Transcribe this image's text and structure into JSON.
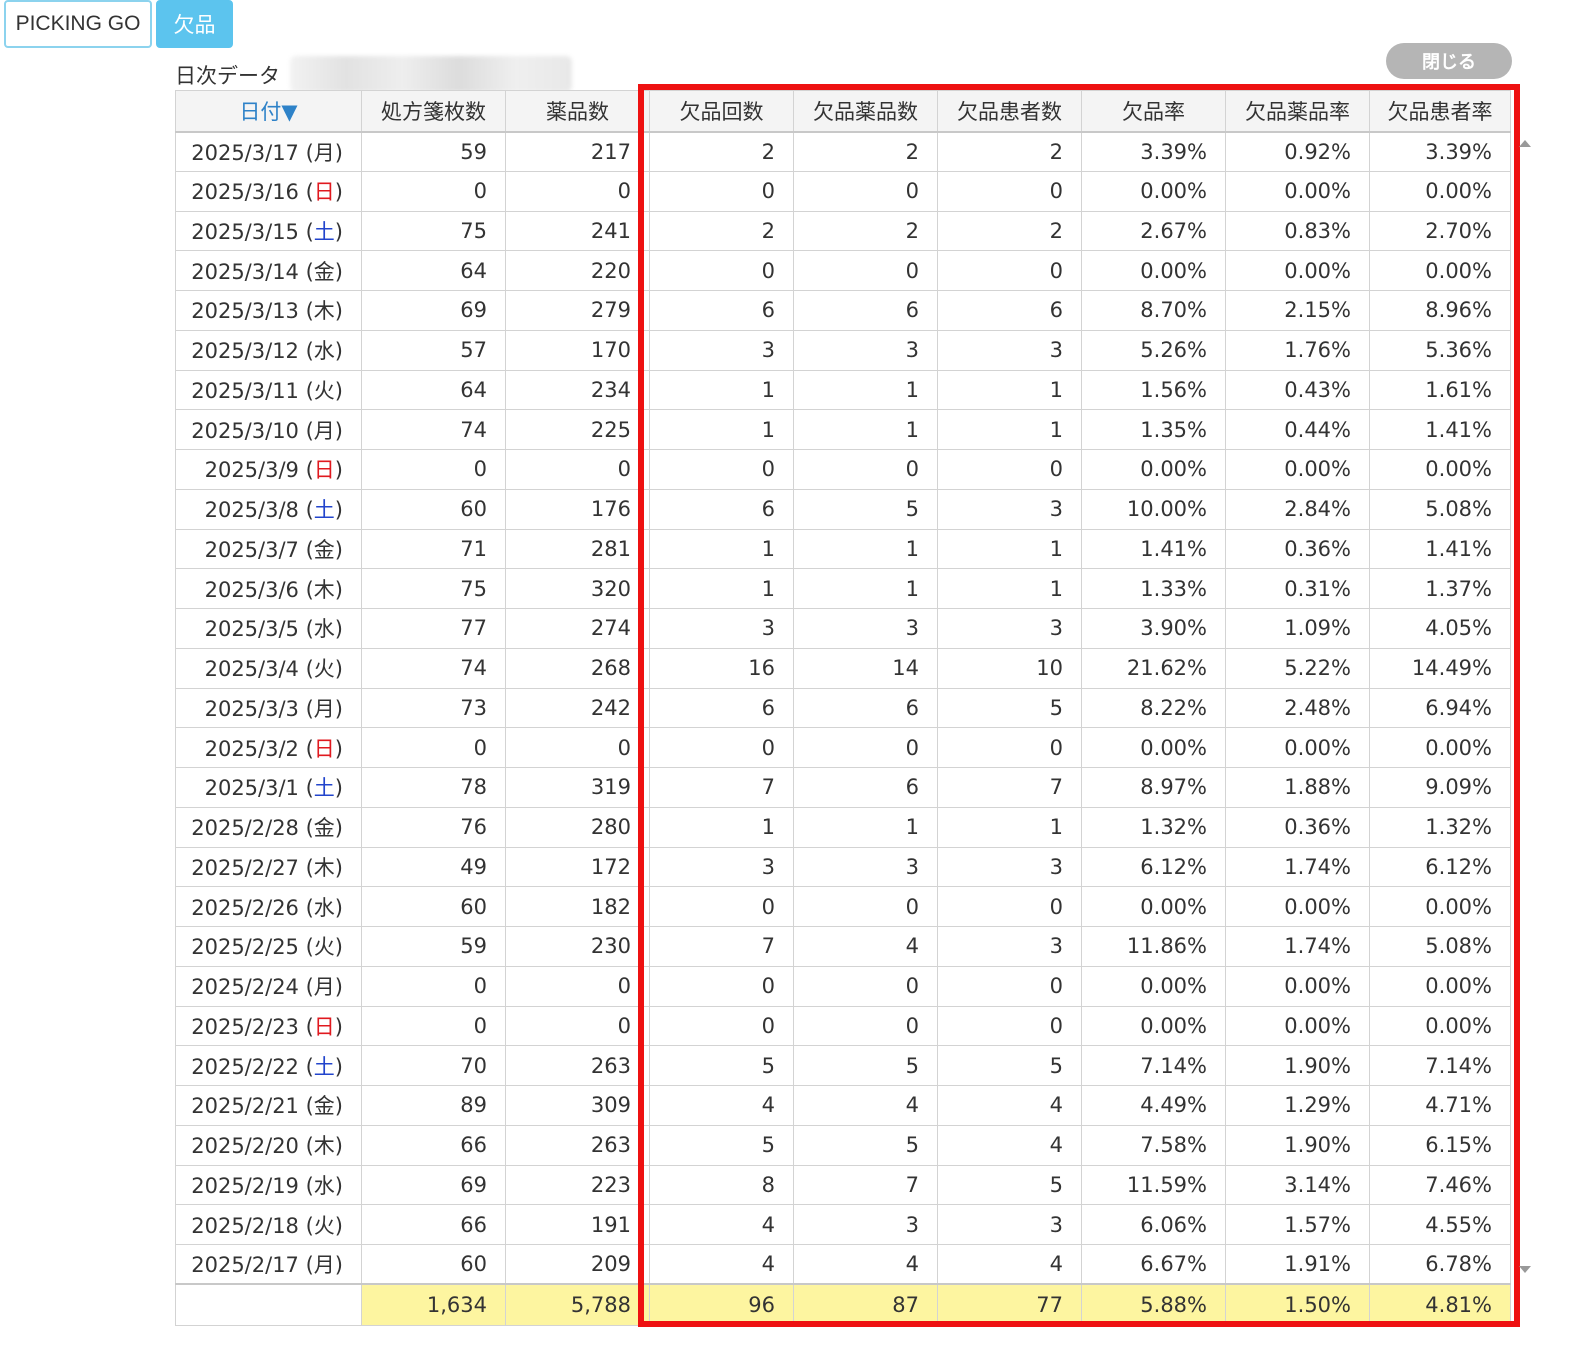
{
  "tabs": {
    "picking_go": "PICKING GO",
    "kepin": "欠品"
  },
  "section": {
    "label": "日次データ",
    "close": "閉じる"
  },
  "columns": [
    "日付▼",
    "処方箋枚数",
    "薬品数",
    "欠品回数",
    "欠品薬品数",
    "欠品患者数",
    "欠品率",
    "欠品薬品率",
    "欠品患者率"
  ],
  "rows": [
    {
      "date": "2025/3/17",
      "wd": "月",
      "cells": [
        "59",
        "217",
        "2",
        "2",
        "2",
        "3.39%",
        "0.92%",
        "3.39%"
      ]
    },
    {
      "date": "2025/3/16",
      "wd": "日",
      "cells": [
        "0",
        "0",
        "0",
        "0",
        "0",
        "0.00%",
        "0.00%",
        "0.00%"
      ]
    },
    {
      "date": "2025/3/15",
      "wd": "土",
      "cells": [
        "75",
        "241",
        "2",
        "2",
        "2",
        "2.67%",
        "0.83%",
        "2.70%"
      ]
    },
    {
      "date": "2025/3/14",
      "wd": "金",
      "cells": [
        "64",
        "220",
        "0",
        "0",
        "0",
        "0.00%",
        "0.00%",
        "0.00%"
      ]
    },
    {
      "date": "2025/3/13",
      "wd": "木",
      "cells": [
        "69",
        "279",
        "6",
        "6",
        "6",
        "8.70%",
        "2.15%",
        "8.96%"
      ]
    },
    {
      "date": "2025/3/12",
      "wd": "水",
      "cells": [
        "57",
        "170",
        "3",
        "3",
        "3",
        "5.26%",
        "1.76%",
        "5.36%"
      ]
    },
    {
      "date": "2025/3/11",
      "wd": "火",
      "cells": [
        "64",
        "234",
        "1",
        "1",
        "1",
        "1.56%",
        "0.43%",
        "1.61%"
      ]
    },
    {
      "date": "2025/3/10",
      "wd": "月",
      "cells": [
        "74",
        "225",
        "1",
        "1",
        "1",
        "1.35%",
        "0.44%",
        "1.41%"
      ]
    },
    {
      "date": "2025/3/9",
      "wd": "日",
      "cells": [
        "0",
        "0",
        "0",
        "0",
        "0",
        "0.00%",
        "0.00%",
        "0.00%"
      ]
    },
    {
      "date": "2025/3/8",
      "wd": "土",
      "cells": [
        "60",
        "176",
        "6",
        "5",
        "3",
        "10.00%",
        "2.84%",
        "5.08%"
      ]
    },
    {
      "date": "2025/3/7",
      "wd": "金",
      "cells": [
        "71",
        "281",
        "1",
        "1",
        "1",
        "1.41%",
        "0.36%",
        "1.41%"
      ]
    },
    {
      "date": "2025/3/6",
      "wd": "木",
      "cells": [
        "75",
        "320",
        "1",
        "1",
        "1",
        "1.33%",
        "0.31%",
        "1.37%"
      ]
    },
    {
      "date": "2025/3/5",
      "wd": "水",
      "cells": [
        "77",
        "274",
        "3",
        "3",
        "3",
        "3.90%",
        "1.09%",
        "4.05%"
      ]
    },
    {
      "date": "2025/3/4",
      "wd": "火",
      "cells": [
        "74",
        "268",
        "16",
        "14",
        "10",
        "21.62%",
        "5.22%",
        "14.49%"
      ]
    },
    {
      "date": "2025/3/3",
      "wd": "月",
      "cells": [
        "73",
        "242",
        "6",
        "6",
        "5",
        "8.22%",
        "2.48%",
        "6.94%"
      ]
    },
    {
      "date": "2025/3/2",
      "wd": "日",
      "cells": [
        "0",
        "0",
        "0",
        "0",
        "0",
        "0.00%",
        "0.00%",
        "0.00%"
      ]
    },
    {
      "date": "2025/3/1",
      "wd": "土",
      "cells": [
        "78",
        "319",
        "7",
        "6",
        "7",
        "8.97%",
        "1.88%",
        "9.09%"
      ]
    },
    {
      "date": "2025/2/28",
      "wd": "金",
      "cells": [
        "76",
        "280",
        "1",
        "1",
        "1",
        "1.32%",
        "0.36%",
        "1.32%"
      ]
    },
    {
      "date": "2025/2/27",
      "wd": "木",
      "cells": [
        "49",
        "172",
        "3",
        "3",
        "3",
        "6.12%",
        "1.74%",
        "6.12%"
      ]
    },
    {
      "date": "2025/2/26",
      "wd": "水",
      "cells": [
        "60",
        "182",
        "0",
        "0",
        "0",
        "0.00%",
        "0.00%",
        "0.00%"
      ]
    },
    {
      "date": "2025/2/25",
      "wd": "火",
      "cells": [
        "59",
        "230",
        "7",
        "4",
        "3",
        "11.86%",
        "1.74%",
        "5.08%"
      ]
    },
    {
      "date": "2025/2/24",
      "wd": "月",
      "cells": [
        "0",
        "0",
        "0",
        "0",
        "0",
        "0.00%",
        "0.00%",
        "0.00%"
      ]
    },
    {
      "date": "2025/2/23",
      "wd": "日",
      "cells": [
        "0",
        "0",
        "0",
        "0",
        "0",
        "0.00%",
        "0.00%",
        "0.00%"
      ]
    },
    {
      "date": "2025/2/22",
      "wd": "土",
      "cells": [
        "70",
        "263",
        "5",
        "5",
        "5",
        "7.14%",
        "1.90%",
        "7.14%"
      ]
    },
    {
      "date": "2025/2/21",
      "wd": "金",
      "cells": [
        "89",
        "309",
        "4",
        "4",
        "4",
        "4.49%",
        "1.29%",
        "4.71%"
      ]
    },
    {
      "date": "2025/2/20",
      "wd": "木",
      "cells": [
        "66",
        "263",
        "5",
        "5",
        "4",
        "7.58%",
        "1.90%",
        "6.15%"
      ]
    },
    {
      "date": "2025/2/19",
      "wd": "水",
      "cells": [
        "69",
        "223",
        "8",
        "7",
        "5",
        "11.59%",
        "3.14%",
        "7.46%"
      ]
    },
    {
      "date": "2025/2/18",
      "wd": "火",
      "cells": [
        "66",
        "191",
        "4",
        "3",
        "3",
        "6.06%",
        "1.57%",
        "4.55%"
      ]
    },
    {
      "date": "2025/2/17",
      "wd": "月",
      "cells": [
        "60",
        "209",
        "4",
        "4",
        "4",
        "6.67%",
        "1.91%",
        "6.78%"
      ]
    }
  ],
  "totals": [
    "1,634",
    "5,788",
    "96",
    "87",
    "77",
    "5.88%",
    "1.50%",
    "4.81%"
  ],
  "colors": {
    "accent_tab": "#5cc4ee",
    "highlight_frame": "#ee1111",
    "total_bg": "#fdf5a0",
    "sunday": "#e0191f",
    "saturday": "#2244cc"
  }
}
